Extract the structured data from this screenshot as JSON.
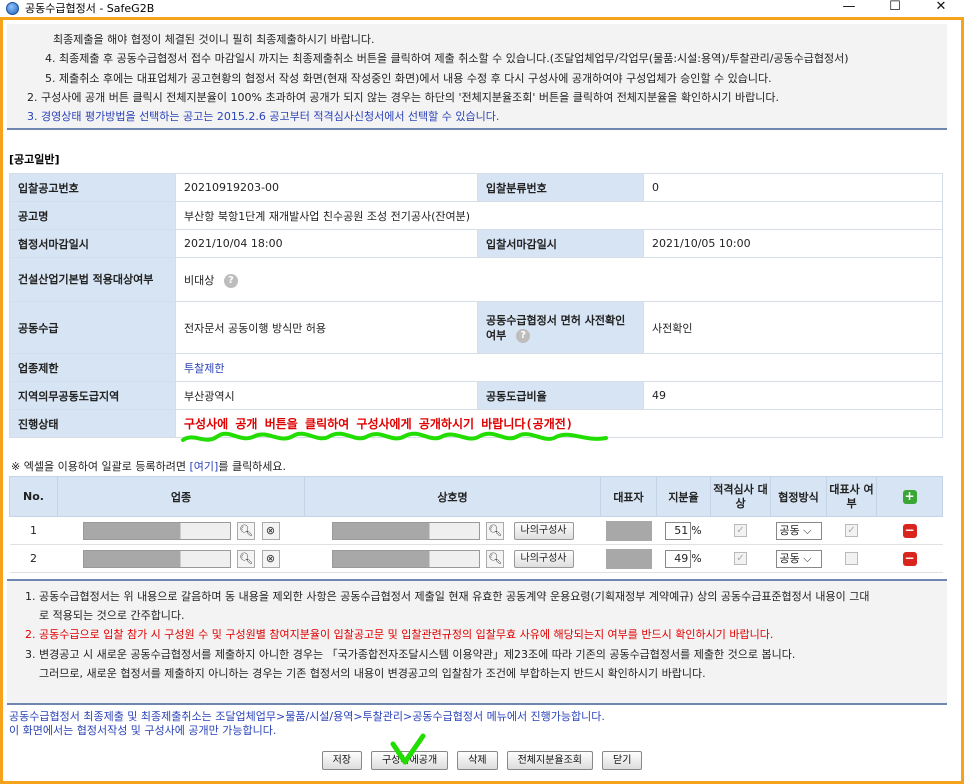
{
  "window": {
    "title": "공동수급협정서 - SafeG2B",
    "minimize": "—",
    "maximize": "☐",
    "close": "✕"
  },
  "notice_top": {
    "lines": [
      "최종제출을 해야 협정이 체결된 것이니 필히 최종제출하시기 바랍니다.",
      "4. 최종제출 후 공동수급협정서 접수 마감일시 까지는 최종제출취소 버튼을 클릭하여 제출 취소할 수 있습니다.(조달업체업무/각업무(물품:시설:용역)/투찰관리/공동수급협정서)",
      "5. 제출취소 후에는 대표업체가 공고현황의 협정서 작성 화면(현재 작성중인 화면)에서 내용 수정 후 다시 구성사에 공개하여야 구성업체가 승인할 수 있습니다.",
      "2. 구성사에 공개 버튼 클릭시 전체지분율이 100% 초과하여 공개가 되지 않는 경우는 하단의 '전체지분율조회' 버튼을 클릭하여 전체지분율을 확인하시기 바랍니다.",
      "3. 경영상태 평가방법을 선택하는 공고는 2015.2.6 공고부터 적격심사신청서에서 선택할 수 있습니다."
    ]
  },
  "section_title": "[공고일반]",
  "info": {
    "bid_no_label": "입찰공고번호",
    "bid_no": "20210919203-00",
    "bid_class_label": "입찰분류번호",
    "bid_class": "0",
    "notice_name_label": "공고명",
    "notice_name": "부산항 북항1단계 재개발사업 친수공원 조성 전기공사(잔여분)",
    "agreement_deadline_label": "협정서마감일시",
    "agreement_deadline": "2021/10/04 18:00",
    "bid_deadline_label": "입찰서마감일시",
    "bid_deadline": "2021/10/05 10:00",
    "construction_act_label": "건설산업기본법 적용대상여부",
    "construction_act": "비대상",
    "joint_supply_label": "공동수급",
    "joint_supply": "전자문서 공동이행 방식만 허용",
    "face_confirm_label": "공동수급협정서 면허 사전확인 여부",
    "face_confirm": "사전확인",
    "industry_limit_label": "업종제한",
    "industry_limit": "투찰제한",
    "region_label": "지역의무공동도급지역",
    "region": "부산광역시",
    "joint_ratio_label": "공동도급비율",
    "joint_ratio": "49",
    "status_label": "진행상태",
    "status": "구성사에 공개 버튼을 클릭하여 구성사에게 공개하시기 바랍니다(공개전)"
  },
  "excel_note": {
    "prefix": "※ 엑셀을 이용하여 일괄로 등록하려면 ",
    "link": "[여기]",
    "suffix": "를 클릭하세요."
  },
  "members": {
    "headers": {
      "no": "No.",
      "industry": "업종",
      "company": "상호명",
      "ceo": "대표자",
      "share": "지분율",
      "qualified": "적격심사 대상",
      "method": "협정방식",
      "rep": "대표사 여부"
    },
    "rows": [
      {
        "no": "1",
        "share": "51",
        "pct": "%",
        "method": "공동",
        "btn": "나의구성사",
        "qualified": true,
        "rep": true
      },
      {
        "no": "2",
        "share": "49",
        "pct": "%",
        "method": "공동",
        "btn": "나의구성사",
        "qualified": true,
        "rep": false
      }
    ]
  },
  "notice_bottom": {
    "l1": "1. 공동수급협정서는 위 내용으로 갈음하며 동 내용을 제외한 사항은 공동수급협정서 제출일 현재 유효한 공동계약 운용요령(기획재정부 계약예규) 상의 공동수급표준협정서 내용이 그대",
    "l1b": "로 적용되는 것으로 간주합니다.",
    "l2": "2. 공동수급으로 입찰 참가 시 구성원 수 및 구성원별 참여지분율이 입찰공고문 및 입찰관련규정의 입찰무효 사유에 해당되는지 여부를 반드시 확인하시기 바랍니다.",
    "l3": "3. 변경공고 시 새로운 공동수급협정서를 제출하지 아니한 경우는 「국가종합전자조달시스템 이용약관」제23조에 따라 기존의 공동수급협정서를 제출한 것으로 봅니다.",
    "l3b": "그러므로, 새로운 협정서를 제출하지 아니하는 경우는 기존 협정서의 내용이 변경공고의 입찰참가 조건에 부합하는지 반드시 확인하시기 바랍니다."
  },
  "footer": {
    "l1": "공동수급협정서 최종제출 및 최종제출취소는 조달업체업무>물품/시설/용역>투찰관리>공동수급협정서 메뉴에서 진행가능합니다.",
    "l2": "이 화면에서는 협정서작성 및 구성사에 공개만 가능합니다."
  },
  "buttons": {
    "save": "저장",
    "publish": "구성사에공개",
    "delete": "삭제",
    "total_share": "전체지분율조회",
    "close": "닫기"
  },
  "colors": {
    "frame": "#f7a21b",
    "header_bg": "#d7e4f3",
    "status_red": "#e00000",
    "link_blue": "#2b43b8",
    "annotation_green": "#22dd00"
  }
}
